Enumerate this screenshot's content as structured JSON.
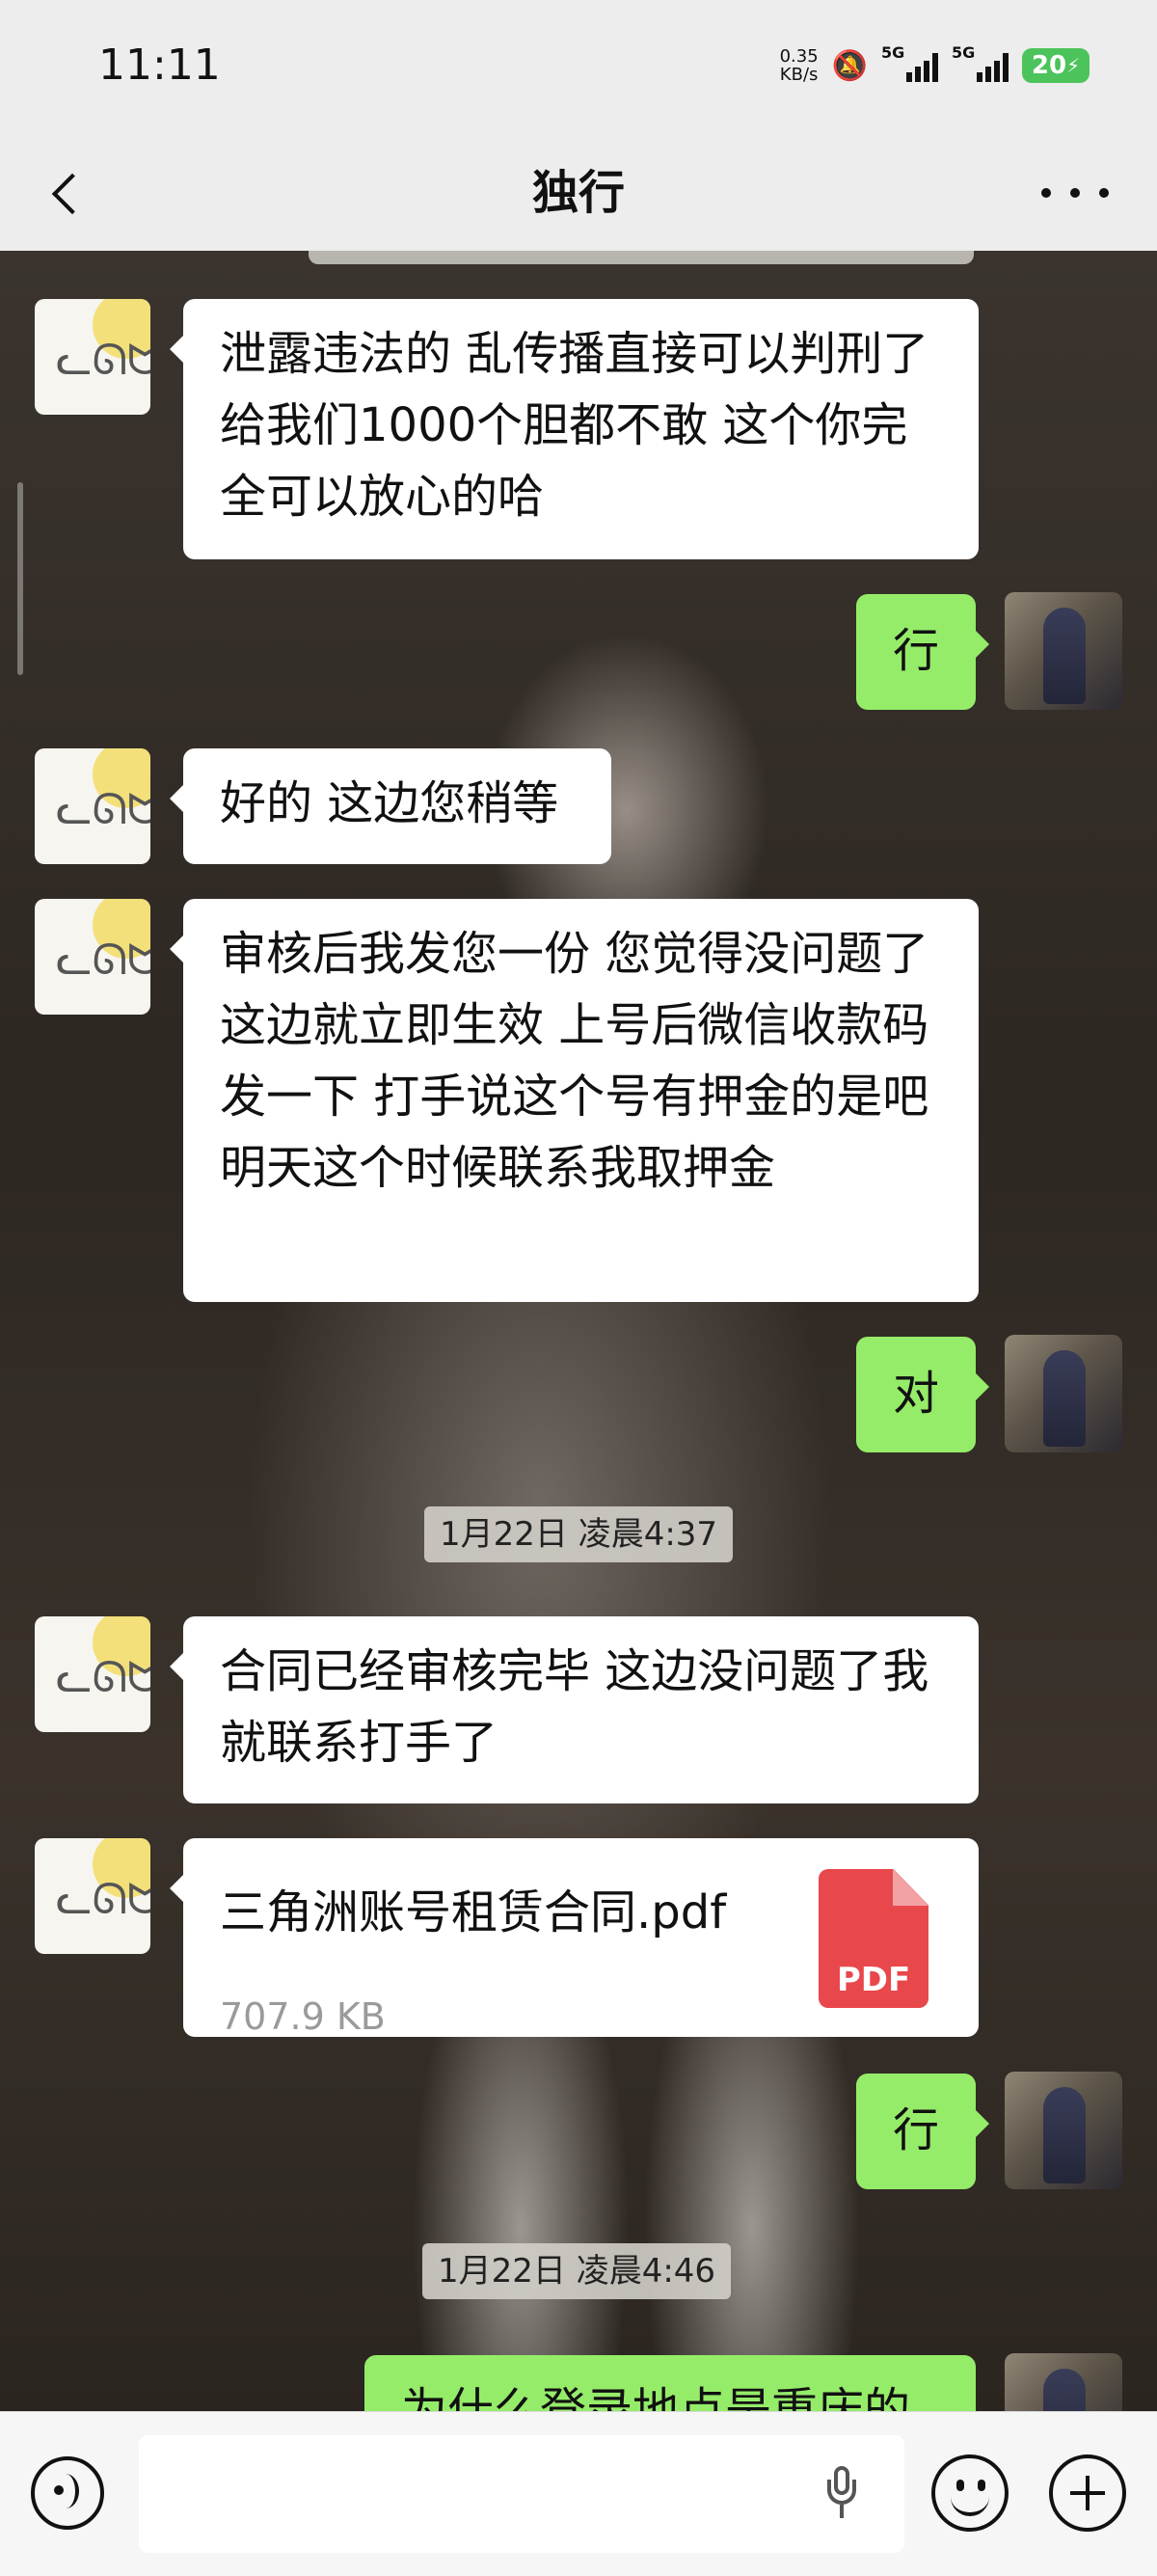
{
  "status_bar": {
    "time": "11:11",
    "net_speed_value": "0.35",
    "net_speed_unit": "KB/s",
    "signal_1": "5G",
    "signal_2": "5G",
    "battery": "20"
  },
  "header": {
    "title": "独行"
  },
  "messages": [
    {
      "side": "left",
      "text": "泄露违法的 乱传播直接可以判刑了 给我们1000个胆都不敢 这个你完全可以放心的哈"
    },
    {
      "side": "right",
      "text": "行"
    },
    {
      "side": "left",
      "text": "好的 这边您稍等"
    },
    {
      "side": "left",
      "text": "审核后我发您一份 您觉得没问题了这边就立即生效 上号后微信收款码发一下 打手说这个号有押金的是吧 明天这个时候联系我取押金"
    },
    {
      "side": "right",
      "text": "对"
    },
    {
      "timestamp": "1月22日 凌晨4:37"
    },
    {
      "side": "left",
      "text": "合同已经审核完毕 这边没问题了我就联系打手了"
    },
    {
      "side": "left",
      "file": {
        "name": "三角洲账号租赁合同.pdf",
        "size": "707.9 KB",
        "type_label": "PDF"
      }
    },
    {
      "side": "right",
      "text": "行"
    },
    {
      "timestamp": "1月22日 凌晨4:46"
    },
    {
      "side": "right",
      "text": "为什么登录地点是重庆的"
    }
  ],
  "input": {
    "placeholder": ""
  }
}
